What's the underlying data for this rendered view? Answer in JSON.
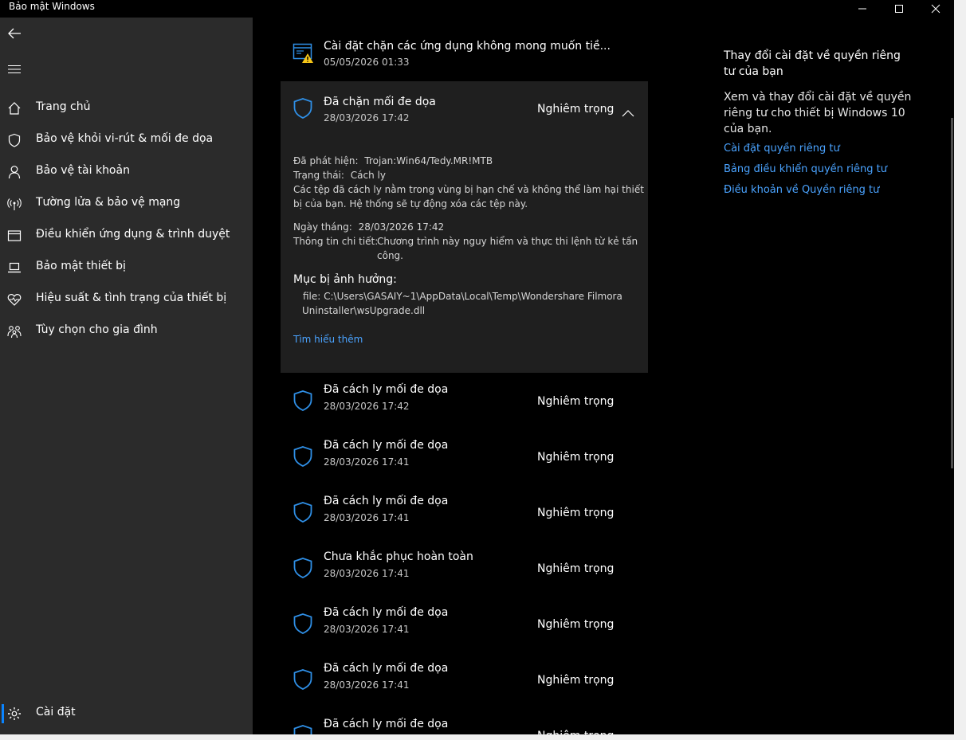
{
  "window": {
    "title": "Bảo mật Windows"
  },
  "sidebar": {
    "items": [
      {
        "label": "Trang chủ",
        "icon": "home-icon"
      },
      {
        "label": "Bảo vệ khỏi vi-rút & mối đe dọa",
        "icon": "shield-icon"
      },
      {
        "label": "Bảo vệ tài khoản",
        "icon": "person-icon"
      },
      {
        "label": "Tường lửa & bảo vệ mạng",
        "icon": "wifi-antenna-icon"
      },
      {
        "label": "Điều khiển ứng dụng & trình duyệt",
        "icon": "browser-window-icon"
      },
      {
        "label": "Bảo mật thiết bị",
        "icon": "laptop-icon"
      },
      {
        "label": "Hiệu suất & tình trạng của thiết bị",
        "icon": "heart-pulse-icon"
      },
      {
        "label": "Tùy chọn cho gia đình",
        "icon": "family-icon"
      }
    ],
    "settings_label": "Cài đặt"
  },
  "history": {
    "top_item": {
      "title": "Cài đặt chặn các ứng dụng không mong muốn tiề...",
      "date": "05/05/2026 01:33"
    },
    "expanded": {
      "title": "Đã chặn mối đe dọa",
      "date": "28/03/2026 17:42",
      "severity": "Nghiêm trọng",
      "detected_label": "Đã phát hiện:",
      "detected_value": "Trojan:Win64/Tedy.MR!MTB",
      "status_label": "Trạng thái:",
      "status_value": "Cách ly",
      "desc_line1": "Các tệp đã cách ly nằm trong vùng bị hạn chế và không thể làm hại thiết",
      "desc_line2": "bị của bạn. Hệ thống sẽ tự động xóa các tệp này.",
      "date_label": "Ngày tháng:",
      "date_value": "28/03/2026 17:42",
      "details_label": "Thông tin chi tiết:",
      "details_line1": "Chương trình này nguy hiểm và thực thi lệnh từ kẻ tấn",
      "details_line2": "công.",
      "affected_heading": "Mục bị ảnh hưởng:",
      "affected_line1": "file: C:\\Users\\GASAIY~1\\AppData\\Local\\Temp\\Wondershare Filmora",
      "affected_line2": "Uninstaller\\wsUpgrade.dll",
      "learn_more": "Tìm hiểu thêm"
    },
    "items": [
      {
        "title": "Đã cách ly mối đe dọa",
        "date": "28/03/2026 17:42",
        "severity": "Nghiêm trọng"
      },
      {
        "title": "Đã cách ly mối đe dọa",
        "date": "28/03/2026 17:41",
        "severity": "Nghiêm trọng"
      },
      {
        "title": "Đã cách ly mối đe dọa",
        "date": "28/03/2026 17:41",
        "severity": "Nghiêm trọng"
      },
      {
        "title": "Chưa khắc phục hoàn toàn",
        "date": "28/03/2026 17:41",
        "severity": "Nghiêm trọng"
      },
      {
        "title": "Đã cách ly mối đe dọa",
        "date": "28/03/2026 17:41",
        "severity": "Nghiêm trọng"
      },
      {
        "title": "Đã cách ly mối đe dọa",
        "date": "28/03/2026 17:41",
        "severity": "Nghiêm trọng"
      },
      {
        "title": "Đã cách ly mối đe dọa",
        "date": "",
        "severity": "Nghiêm trọng"
      }
    ]
  },
  "privacy": {
    "heading": "Thay đổi cài đặt về quyền riêng tư của bạn",
    "description": "Xem và thay đổi cài đặt về quyền riêng tư cho thiết bị Windows 10 của bạn.",
    "links": [
      "Cài đặt quyền riêng tư",
      "Bảng điều khiển quyền riêng tư",
      "Điều khoản về Quyền riêng tư"
    ]
  },
  "colors": {
    "accent": "#0a84ff",
    "link": "#4aa3ff",
    "shield": "#2f8fe6",
    "warning": "#f5c518"
  }
}
